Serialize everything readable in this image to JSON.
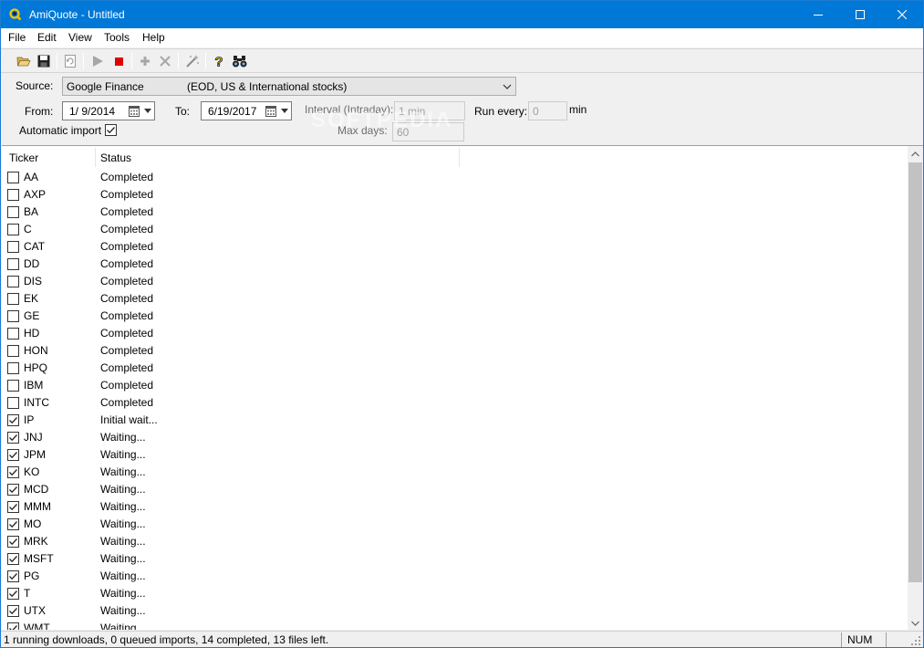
{
  "window": {
    "title": "AmiQuote - Untitled",
    "accent_color": "#0078d7"
  },
  "menu": [
    "File",
    "Edit",
    "View",
    "Tools",
    "Help"
  ],
  "toolbar": {
    "icons": [
      "open-folder-icon",
      "save-icon",
      "refresh-icon",
      "play-icon",
      "stop-icon",
      "add-icon",
      "delete-icon",
      "wand-icon",
      "help-icon",
      "find-icon"
    ]
  },
  "settings": {
    "source_label": "Source:",
    "source_name": "Google Finance",
    "source_desc": "(EOD, US & International stocks)",
    "from_label": "From:",
    "from_value": "1/  9/2014",
    "to_label": "To:",
    "to_value": "6/19/2017",
    "interval_label": "Interval (Intraday):",
    "interval_value": "1 min",
    "run_every_label": "Run every:",
    "run_every_value": "0",
    "run_every_unit": "min",
    "auto_import_label": "Automatic import",
    "auto_import_checked": true,
    "max_days_label": "Max days:",
    "max_days_value": "60"
  },
  "list": {
    "columns": [
      "Ticker",
      "Status"
    ],
    "rows": [
      {
        "ticker": "AA",
        "status": "Completed",
        "checked": false
      },
      {
        "ticker": "AXP",
        "status": "Completed",
        "checked": false
      },
      {
        "ticker": "BA",
        "status": "Completed",
        "checked": false
      },
      {
        "ticker": "C",
        "status": "Completed",
        "checked": false
      },
      {
        "ticker": "CAT",
        "status": "Completed",
        "checked": false
      },
      {
        "ticker": "DD",
        "status": "Completed",
        "checked": false
      },
      {
        "ticker": "DIS",
        "status": "Completed",
        "checked": false
      },
      {
        "ticker": "EK",
        "status": "Completed",
        "checked": false
      },
      {
        "ticker": "GE",
        "status": "Completed",
        "checked": false
      },
      {
        "ticker": "HD",
        "status": "Completed",
        "checked": false
      },
      {
        "ticker": "HON",
        "status": "Completed",
        "checked": false
      },
      {
        "ticker": "HPQ",
        "status": "Completed",
        "checked": false
      },
      {
        "ticker": "IBM",
        "status": "Completed",
        "checked": false
      },
      {
        "ticker": "INTC",
        "status": "Completed",
        "checked": false
      },
      {
        "ticker": "IP",
        "status": "Initial wait...",
        "checked": true
      },
      {
        "ticker": "JNJ",
        "status": "Waiting...",
        "checked": true
      },
      {
        "ticker": "JPM",
        "status": "Waiting...",
        "checked": true
      },
      {
        "ticker": "KO",
        "status": "Waiting...",
        "checked": true
      },
      {
        "ticker": "MCD",
        "status": "Waiting...",
        "checked": true
      },
      {
        "ticker": "MMM",
        "status": "Waiting...",
        "checked": true
      },
      {
        "ticker": "MO",
        "status": "Waiting...",
        "checked": true
      },
      {
        "ticker": "MRK",
        "status": "Waiting...",
        "checked": true
      },
      {
        "ticker": "MSFT",
        "status": "Waiting...",
        "checked": true
      },
      {
        "ticker": "PG",
        "status": "Waiting...",
        "checked": true
      },
      {
        "ticker": "T",
        "status": "Waiting...",
        "checked": true
      },
      {
        "ticker": "UTX",
        "status": "Waiting...",
        "checked": true
      },
      {
        "ticker": "WMT",
        "status": "Waiting...",
        "checked": true
      }
    ]
  },
  "statusbar": {
    "message": "1 running downloads, 0 queued imports, 14 completed, 13 files left.",
    "num": "NUM"
  },
  "watermark": "SOFTPEDIA"
}
